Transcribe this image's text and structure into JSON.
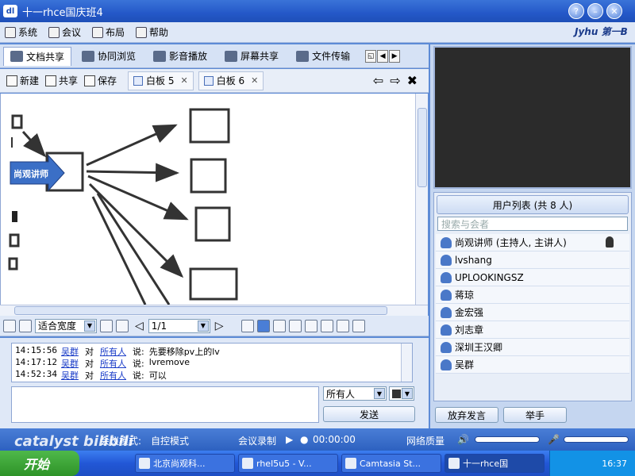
{
  "window": {
    "title": "十一rhce国庆班4"
  },
  "menu": {
    "items": [
      "系统",
      "会议",
      "布局",
      "帮助"
    ],
    "brand": "第一B"
  },
  "tabs": {
    "items": [
      "文档共享",
      "协同浏览",
      "影音播放",
      "屏幕共享",
      "文件传输"
    ]
  },
  "toolbar": {
    "new": "新建",
    "share": "共享",
    "save": "保存",
    "whiteboards": [
      "白板 5",
      "白板 6"
    ]
  },
  "canvas": {
    "callout": "尚观讲师"
  },
  "viewbar": {
    "zoom": "适合宽度",
    "page": "1/1"
  },
  "chat": {
    "messages": [
      {
        "time": "14:15:56",
        "from": "吴群",
        "to_word": "对",
        "to": "所有人",
        "say": "说:",
        "text": "先要移除pv上的lv"
      },
      {
        "time": "14:17:12",
        "from": "吴群",
        "to_word": "对",
        "to": "所有人",
        "say": "说:",
        "text": "lvremove"
      },
      {
        "time": "14:52:34",
        "from": "吴群",
        "to_word": "对",
        "to": "所有人",
        "say": "说:",
        "text": "可以"
      }
    ],
    "recipient": "所有人",
    "send": "发送"
  },
  "userlist": {
    "header": "用户列表 (共 8 人)",
    "search_placeholder": "搜索与会者",
    "users": [
      "尚观讲师 (主持人, 主讲人)",
      "lvshang",
      "UPLOOKINGSZ",
      "蒋琼",
      "金宏强",
      "刘志章",
      "深圳王汉卿",
      "吴群"
    ]
  },
  "panel_buttons": {
    "release": "放弃发言",
    "raise": "举手"
  },
  "status": {
    "mode_label": "会议模式:",
    "mode": "自控模式",
    "record": "会议录制",
    "time": "00:00:00",
    "quality": "网络质量"
  },
  "taskbar": {
    "start": "开始",
    "tasks": [
      "北京尚观科...",
      "rhel5u5 - V...",
      "Camtasia St...",
      "十一rhce国"
    ],
    "clock": "16:37"
  },
  "watermark": "catalyst bilibili"
}
